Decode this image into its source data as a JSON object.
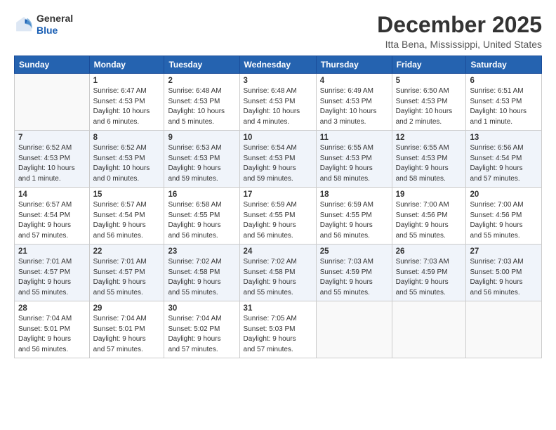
{
  "logo": {
    "general": "General",
    "blue": "Blue"
  },
  "title": "December 2025",
  "location": "Itta Bena, Mississippi, United States",
  "days_of_week": [
    "Sunday",
    "Monday",
    "Tuesday",
    "Wednesday",
    "Thursday",
    "Friday",
    "Saturday"
  ],
  "weeks": [
    [
      {
        "day": "",
        "info": ""
      },
      {
        "day": "1",
        "info": "Sunrise: 6:47 AM\nSunset: 4:53 PM\nDaylight: 10 hours\nand 6 minutes."
      },
      {
        "day": "2",
        "info": "Sunrise: 6:48 AM\nSunset: 4:53 PM\nDaylight: 10 hours\nand 5 minutes."
      },
      {
        "day": "3",
        "info": "Sunrise: 6:48 AM\nSunset: 4:53 PM\nDaylight: 10 hours\nand 4 minutes."
      },
      {
        "day": "4",
        "info": "Sunrise: 6:49 AM\nSunset: 4:53 PM\nDaylight: 10 hours\nand 3 minutes."
      },
      {
        "day": "5",
        "info": "Sunrise: 6:50 AM\nSunset: 4:53 PM\nDaylight: 10 hours\nand 2 minutes."
      },
      {
        "day": "6",
        "info": "Sunrise: 6:51 AM\nSunset: 4:53 PM\nDaylight: 10 hours\nand 1 minute."
      }
    ],
    [
      {
        "day": "7",
        "info": "Sunrise: 6:52 AM\nSunset: 4:53 PM\nDaylight: 10 hours\nand 1 minute."
      },
      {
        "day": "8",
        "info": "Sunrise: 6:52 AM\nSunset: 4:53 PM\nDaylight: 10 hours\nand 0 minutes."
      },
      {
        "day": "9",
        "info": "Sunrise: 6:53 AM\nSunset: 4:53 PM\nDaylight: 9 hours\nand 59 minutes."
      },
      {
        "day": "10",
        "info": "Sunrise: 6:54 AM\nSunset: 4:53 PM\nDaylight: 9 hours\nand 59 minutes."
      },
      {
        "day": "11",
        "info": "Sunrise: 6:55 AM\nSunset: 4:53 PM\nDaylight: 9 hours\nand 58 minutes."
      },
      {
        "day": "12",
        "info": "Sunrise: 6:55 AM\nSunset: 4:53 PM\nDaylight: 9 hours\nand 58 minutes."
      },
      {
        "day": "13",
        "info": "Sunrise: 6:56 AM\nSunset: 4:54 PM\nDaylight: 9 hours\nand 57 minutes."
      }
    ],
    [
      {
        "day": "14",
        "info": "Sunrise: 6:57 AM\nSunset: 4:54 PM\nDaylight: 9 hours\nand 57 minutes."
      },
      {
        "day": "15",
        "info": "Sunrise: 6:57 AM\nSunset: 4:54 PM\nDaylight: 9 hours\nand 56 minutes."
      },
      {
        "day": "16",
        "info": "Sunrise: 6:58 AM\nSunset: 4:55 PM\nDaylight: 9 hours\nand 56 minutes."
      },
      {
        "day": "17",
        "info": "Sunrise: 6:59 AM\nSunset: 4:55 PM\nDaylight: 9 hours\nand 56 minutes."
      },
      {
        "day": "18",
        "info": "Sunrise: 6:59 AM\nSunset: 4:55 PM\nDaylight: 9 hours\nand 56 minutes."
      },
      {
        "day": "19",
        "info": "Sunrise: 7:00 AM\nSunset: 4:56 PM\nDaylight: 9 hours\nand 55 minutes."
      },
      {
        "day": "20",
        "info": "Sunrise: 7:00 AM\nSunset: 4:56 PM\nDaylight: 9 hours\nand 55 minutes."
      }
    ],
    [
      {
        "day": "21",
        "info": "Sunrise: 7:01 AM\nSunset: 4:57 PM\nDaylight: 9 hours\nand 55 minutes."
      },
      {
        "day": "22",
        "info": "Sunrise: 7:01 AM\nSunset: 4:57 PM\nDaylight: 9 hours\nand 55 minutes."
      },
      {
        "day": "23",
        "info": "Sunrise: 7:02 AM\nSunset: 4:58 PM\nDaylight: 9 hours\nand 55 minutes."
      },
      {
        "day": "24",
        "info": "Sunrise: 7:02 AM\nSunset: 4:58 PM\nDaylight: 9 hours\nand 55 minutes."
      },
      {
        "day": "25",
        "info": "Sunrise: 7:03 AM\nSunset: 4:59 PM\nDaylight: 9 hours\nand 55 minutes."
      },
      {
        "day": "26",
        "info": "Sunrise: 7:03 AM\nSunset: 4:59 PM\nDaylight: 9 hours\nand 55 minutes."
      },
      {
        "day": "27",
        "info": "Sunrise: 7:03 AM\nSunset: 5:00 PM\nDaylight: 9 hours\nand 56 minutes."
      }
    ],
    [
      {
        "day": "28",
        "info": "Sunrise: 7:04 AM\nSunset: 5:01 PM\nDaylight: 9 hours\nand 56 minutes."
      },
      {
        "day": "29",
        "info": "Sunrise: 7:04 AM\nSunset: 5:01 PM\nDaylight: 9 hours\nand 57 minutes."
      },
      {
        "day": "30",
        "info": "Sunrise: 7:04 AM\nSunset: 5:02 PM\nDaylight: 9 hours\nand 57 minutes."
      },
      {
        "day": "31",
        "info": "Sunrise: 7:05 AM\nSunset: 5:03 PM\nDaylight: 9 hours\nand 57 minutes."
      },
      {
        "day": "",
        "info": ""
      },
      {
        "day": "",
        "info": ""
      },
      {
        "day": "",
        "info": ""
      }
    ]
  ]
}
